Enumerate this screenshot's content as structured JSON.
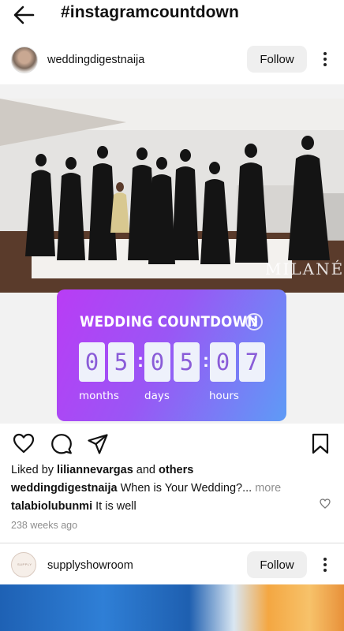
{
  "header": {
    "title": "#instagramcountdown",
    "back_icon": "arrow-left-icon"
  },
  "post": {
    "username": "weddingdigestnaija",
    "follow_label": "Follow",
    "more_icon": "more-vertical-icon",
    "watermark": "MILANÉS",
    "countdown": {
      "title": "WEDDING COUNTDOWN",
      "digits": [
        "0",
        "5",
        "0",
        "5",
        "0",
        "7"
      ],
      "units": [
        "months",
        "days",
        "hours"
      ],
      "gradient": [
        "#b93cf5",
        "#5e9bf6"
      ],
      "digit_color": "#8a5cd8"
    },
    "liked_prefix": "Liked by ",
    "liked_user": "liliannevargas",
    "liked_middle": " and ",
    "liked_suffix": "others",
    "caption_user": "weddingdigestnaija",
    "caption_text": " When is Your Wedding?...",
    "caption_more": " more",
    "comment_user": "talabiolubunmi",
    "comment_text": " It is well",
    "timestamp": "238 weeks ago"
  },
  "post2": {
    "username": "supplyshowroom",
    "follow_label": "Follow",
    "avatar_text": "SUPPLY"
  }
}
